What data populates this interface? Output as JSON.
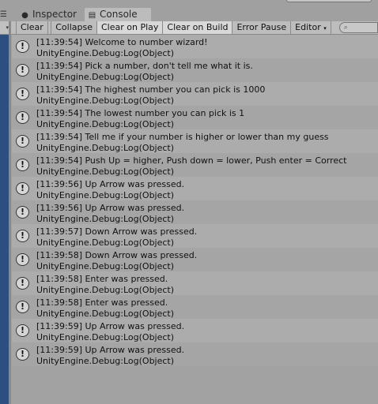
{
  "tabs": [
    {
      "label": "Inspector",
      "icon": "info-icon"
    },
    {
      "label": "Console",
      "icon": "console-icon",
      "active": true
    }
  ],
  "toolbar": {
    "clear": "Clear",
    "collapse": "Collapse",
    "clear_on_play": "Clear on Play",
    "clear_on_build": "Clear on Build",
    "error_pause": "Error Pause",
    "editor": "Editor",
    "editor_arrow": "▾",
    "search_placeholder": ""
  },
  "log": [
    {
      "message": "[11:39:54] Welcome to number wizard!",
      "trace": "UnityEngine.Debug:Log(Object)"
    },
    {
      "message": "[11:39:54] Pick a number, don't tell me what it is.",
      "trace": "UnityEngine.Debug:Log(Object)"
    },
    {
      "message": "[11:39:54] The highest number you can pick is 1000",
      "trace": "UnityEngine.Debug:Log(Object)"
    },
    {
      "message": "[11:39:54] The lowest number you can pick is 1",
      "trace": "UnityEngine.Debug:Log(Object)"
    },
    {
      "message": "[11:39:54] Tell me if your number is higher or lower than my guess",
      "trace": "UnityEngine.Debug:Log(Object)"
    },
    {
      "message": "[11:39:54] Push Up = higher, Push down = lower, Push enter = Correct",
      "trace": "UnityEngine.Debug:Log(Object)"
    },
    {
      "message": "[11:39:56] Up Arrow was pressed.",
      "trace": "UnityEngine.Debug:Log(Object)"
    },
    {
      "message": "[11:39:56] Up Arrow was pressed.",
      "trace": "UnityEngine.Debug:Log(Object)"
    },
    {
      "message": "[11:39:57] Down Arrow was pressed.",
      "trace": "UnityEngine.Debug:Log(Object)"
    },
    {
      "message": "[11:39:58] Down Arrow was pressed.",
      "trace": "UnityEngine.Debug:Log(Object)"
    },
    {
      "message": "[11:39:58] Enter was pressed.",
      "trace": "UnityEngine.Debug:Log(Object)"
    },
    {
      "message": "[11:39:58] Enter was pressed.",
      "trace": "UnityEngine.Debug:Log(Object)"
    },
    {
      "message": "[11:39:59] Up Arrow was pressed.",
      "trace": "UnityEngine.Debug:Log(Object)"
    },
    {
      "message": "[11:39:59] Up Arrow was pressed.",
      "trace": "UnityEngine.Debug:Log(Object)"
    }
  ]
}
